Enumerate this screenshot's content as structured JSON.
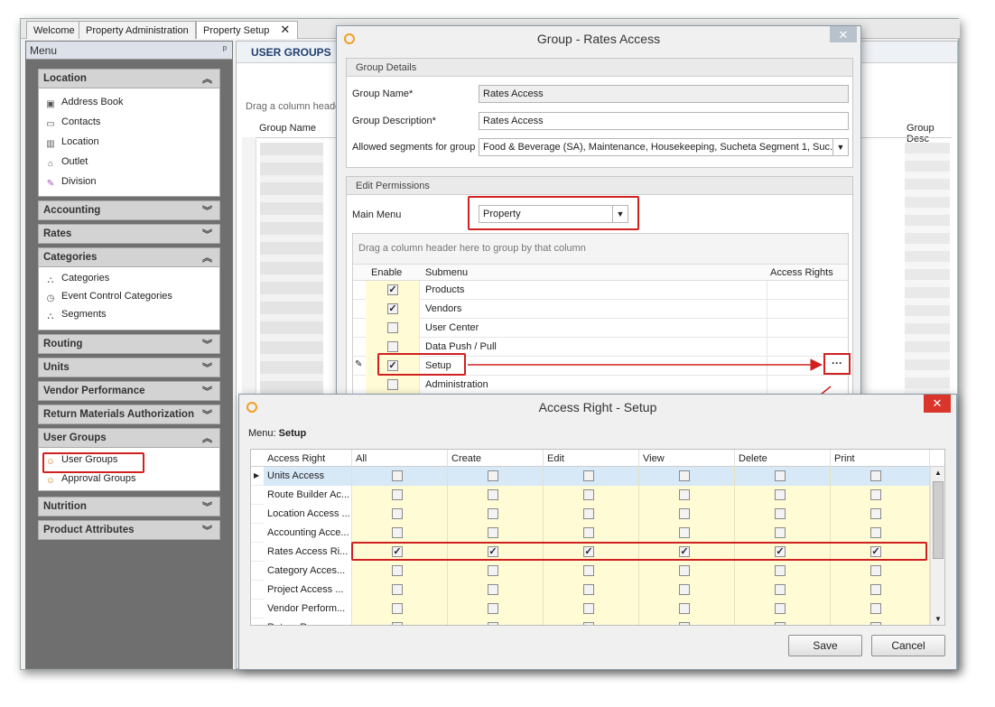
{
  "tabs": [
    "Welcome",
    "Property Administration",
    "Property Setup"
  ],
  "tab_close": "✕",
  "menu": {
    "title": "Menu",
    "groups": [
      {
        "label": "Location",
        "items": [
          "Address Book",
          "Contacts",
          "Location",
          "Outlet",
          "Division"
        ]
      },
      {
        "label": "Accounting"
      },
      {
        "label": "Rates"
      },
      {
        "label": "Categories",
        "items": [
          "Categories",
          "Event Control Categories",
          "Segments"
        ]
      },
      {
        "label": "Routing"
      },
      {
        "label": "Units"
      },
      {
        "label": "Vendor Performance"
      },
      {
        "label": "Return Materials Authorization"
      },
      {
        "label": "User Groups",
        "items": [
          "User Groups",
          "Approval Groups"
        ]
      },
      {
        "label": "Nutrition"
      },
      {
        "label": "Product Attributes"
      }
    ]
  },
  "content": {
    "title": "USER GROUPS",
    "drag_hint": "Drag a column heade",
    "col_group_name": "Group Name",
    "col_group_desc": "Group Desc"
  },
  "group_dialog": {
    "title": "Group - Rates Access",
    "details_header": "Group Details",
    "group_name_label": "Group Name*",
    "group_name_value": "Rates Access",
    "group_desc_label": "Group Description*",
    "group_desc_value": "Rates Access",
    "segments_label": "Allowed segments for group",
    "segments_value": "Food & Beverage (SA), Maintenance, Housekeeping, Sucheta Segment 1, Suc...",
    "permissions_header": "Edit Permissions",
    "main_menu_label": "Main Menu",
    "main_menu_value": "Property",
    "drag_hint": "Drag a column header here to group by that column",
    "columns": [
      "Enable",
      "Submenu",
      "Access Rights"
    ],
    "rows": [
      {
        "name": "Products",
        "enabled": true
      },
      {
        "name": "Vendors",
        "enabled": true
      },
      {
        "name": "User Center",
        "enabled": false
      },
      {
        "name": "Data Push / Pull",
        "enabled": false
      },
      {
        "name": "Setup",
        "enabled": true
      },
      {
        "name": "Administration",
        "enabled": false
      }
    ],
    "ellipsis": "···"
  },
  "access_dialog": {
    "title": "Access Right - Setup",
    "menu_label": "Menu:",
    "menu_value": "Setup",
    "columns": [
      "Access Right",
      "All",
      "Create",
      "Edit",
      "View",
      "Delete",
      "Print"
    ],
    "rows": [
      {
        "name": "Units Access",
        "checked": false
      },
      {
        "name": "Route Builder Ac...",
        "checked": false
      },
      {
        "name": "Location Access ...",
        "checked": false
      },
      {
        "name": "Accounting Acce...",
        "checked": false
      },
      {
        "name": "Rates Access Ri...",
        "checked": true
      },
      {
        "name": "Category Acces...",
        "checked": false
      },
      {
        "name": "Project Access ...",
        "checked": false
      },
      {
        "name": "Vendor Perform...",
        "checked": false
      },
      {
        "name": "Return Ro...",
        "checked": false
      }
    ],
    "save_label": "Save",
    "cancel_label": "Cancel",
    "close_label": "✕"
  },
  "colors": {
    "highlight": "#d02020",
    "selected_row": "#d7e8f7",
    "grid_yellow": "#fffbd5"
  }
}
